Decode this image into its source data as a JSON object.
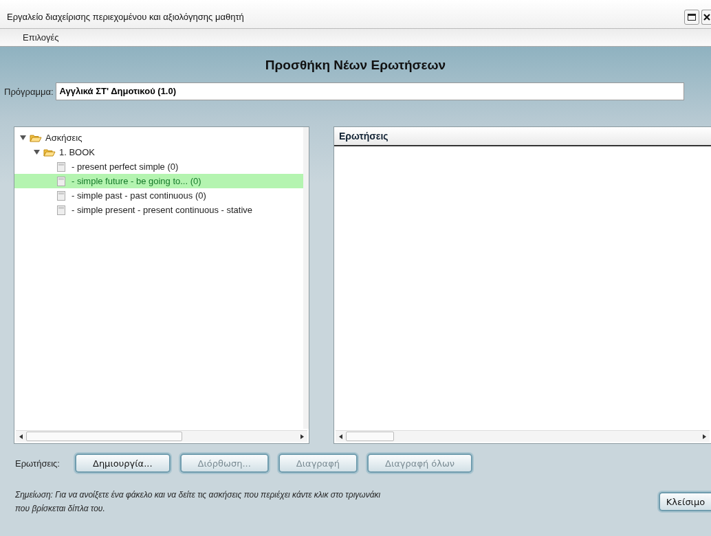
{
  "window": {
    "title": "Εργαλείο διαχείρισης περιεχομένου και αξιολόγησης μαθητή"
  },
  "menu": [
    "Επιλογές"
  ],
  "heading": "Προσθήκη Νέων Ερωτήσεων",
  "program": {
    "label": "Πρόγραμμα:",
    "value": "Αγγλικά ΣΤ' Δημοτικού (1.0)"
  },
  "tree": [
    {
      "kind": "folder",
      "label": "Ασκήσεις",
      "expanded": true,
      "selected": false,
      "children": [
        {
          "kind": "folder",
          "label": "1.  BOOK",
          "expanded": true,
          "selected": false,
          "children": [
            {
              "kind": "doc",
              "label": "- present perfect simple  (0)",
              "selected": false
            },
            {
              "kind": "doc",
              "label": "- simple future - be going to...  (0)",
              "selected": true
            },
            {
              "kind": "doc",
              "label": "- simple past - past continuous  (0)",
              "selected": false
            },
            {
              "kind": "doc",
              "label": "- simple present - present continuous - stative",
              "selected": false
            }
          ]
        }
      ]
    }
  ],
  "questions": {
    "column": "Ερωτήσεις"
  },
  "actions": {
    "label": "Ερωτήσεις:",
    "buttons": [
      {
        "label": "Δημιουργία...",
        "disabled": false
      },
      {
        "label": "Διόρθωση...",
        "disabled": true
      },
      {
        "label": "Διαγραφή",
        "disabled": true
      },
      {
        "label": "Διαγραφή όλων",
        "disabled": true
      }
    ]
  },
  "note": "Σημείωση: Για να ανοίξετε ένα φάκελο και να δείτε τις ασκήσεις που περιέχει κάντε κλικ στο τριγωνάκι που βρίσκεται δίπλα του.",
  "close_button": "Κλείσιμο"
}
